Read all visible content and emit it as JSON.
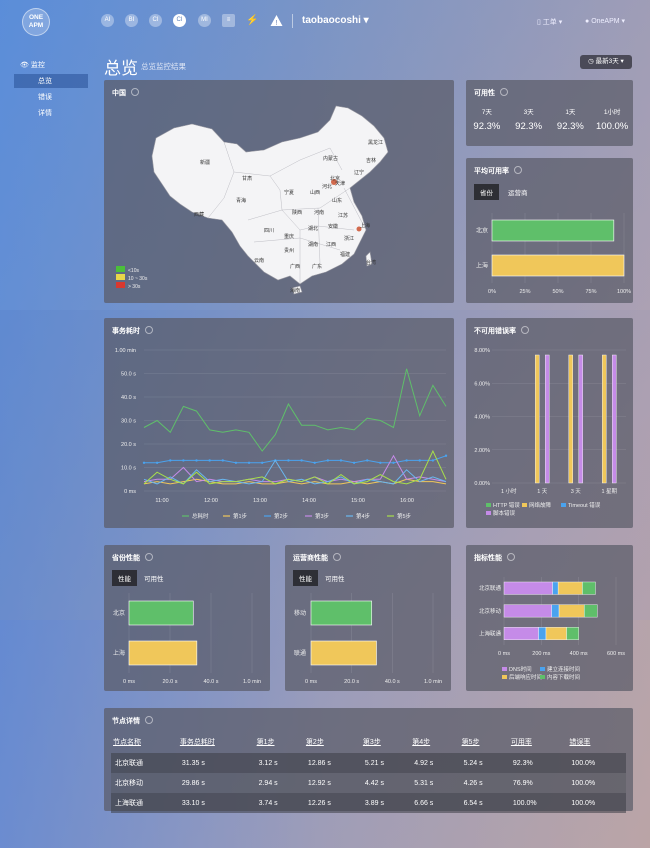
{
  "colors": {
    "green": "#5fbf6a",
    "yellow": "#f0c75a",
    "blue": "#4aa3ef",
    "purple": "#c58be8",
    "lime": "#a8e04a",
    "red": "#d9382f",
    "panel": "#5a5c68"
  },
  "topbar": {
    "logo_line1": "ONE",
    "logo_line2": "APM",
    "nav": [
      {
        "icon": "ai-icon",
        "label": "AI"
      },
      {
        "icon": "bi-icon",
        "label": "BI"
      },
      {
        "icon": "ci-icon",
        "label": "CI"
      },
      {
        "icon": "cloud-insight-icon",
        "label": "CI"
      },
      {
        "icon": "mi-icon",
        "label": "MI"
      },
      {
        "icon": "grid-icon",
        "label": "≡"
      },
      {
        "icon": "plug-icon",
        "label": "⚡"
      },
      {
        "icon": "alert-icon",
        "label": "!"
      }
    ],
    "app_name": "taobaocoshi ▾",
    "workorder": "工单 ▾",
    "user": "OneAPM ▾"
  },
  "sidebar": {
    "section": "监控",
    "items": [
      {
        "label": "总览"
      },
      {
        "label": "错误"
      },
      {
        "label": "详情"
      }
    ]
  },
  "header": {
    "title": "总览",
    "subtitle": "总览监控结果",
    "range": "最新3天 ▾"
  },
  "map": {
    "title": "中国",
    "legend": [
      "<10s",
      "10 ~ 30s",
      "> 30s"
    ],
    "provinces": [
      {
        "name": "黑龙江"
      },
      {
        "name": "吉林"
      },
      {
        "name": "辽宁"
      },
      {
        "name": "内蒙古"
      },
      {
        "name": "北京"
      },
      {
        "name": "天津"
      },
      {
        "name": "河北"
      },
      {
        "name": "新疆"
      },
      {
        "name": "甘肃"
      },
      {
        "name": "宁夏"
      },
      {
        "name": "山西"
      },
      {
        "name": "山东"
      },
      {
        "name": "青海"
      },
      {
        "name": "陕西"
      },
      {
        "name": "河南"
      },
      {
        "name": "江苏"
      },
      {
        "name": "西藏"
      },
      {
        "name": "四川"
      },
      {
        "name": "湖北"
      },
      {
        "name": "安徽"
      },
      {
        "name": "上海"
      },
      {
        "name": "重庆"
      },
      {
        "name": "浙江"
      },
      {
        "name": "湖南"
      },
      {
        "name": "江西"
      },
      {
        "name": "贵州"
      },
      {
        "name": "福建"
      },
      {
        "name": "云南"
      },
      {
        "name": "广西"
      },
      {
        "name": "广东"
      },
      {
        "name": "台湾"
      },
      {
        "name": "海南"
      }
    ]
  },
  "availability": {
    "title": "可用性",
    "headers": [
      "7天",
      "3天",
      "1天",
      "1小时"
    ],
    "values": [
      "92.3%",
      "92.3%",
      "92.3%",
      "100.0%"
    ]
  },
  "avg_availability": {
    "title": "平均可用率",
    "tabs": [
      "省份",
      "运营商"
    ],
    "chart_data": {
      "type": "bar",
      "orientation": "horizontal",
      "categories": [
        "北京",
        "上海"
      ],
      "values": [
        92.3,
        100
      ],
      "xticks": [
        "0%",
        "25%",
        "50%",
        "75%",
        "100%"
      ],
      "xlim": [
        0,
        100
      ]
    }
  },
  "txn_time": {
    "title": "事务耗时",
    "chart_data": {
      "type": "line",
      "yticks": [
        "0 ms",
        "10.0 s",
        "20.0 s",
        "30.0 s",
        "40.0 s",
        "50.0 s",
        "1.00 min"
      ],
      "xticks": [
        "11:00",
        "12:00",
        "13:00",
        "14:00",
        "15:00",
        "16:00"
      ],
      "ylim": [
        0,
        60
      ],
      "series": [
        {
          "name": "总耗时",
          "values": [
            27,
            30,
            25,
            36,
            34,
            26,
            25,
            26,
            25,
            17,
            24,
            37,
            28,
            28,
            26,
            27,
            26,
            31,
            30,
            27,
            52,
            32,
            45,
            36
          ]
        },
        {
          "name": "第1步",
          "values": [
            3,
            4,
            3,
            4,
            5,
            4,
            3,
            3,
            4,
            3,
            3,
            4,
            3,
            4,
            3,
            3,
            4,
            3,
            4,
            3,
            5,
            4,
            4,
            3
          ]
        },
        {
          "name": "第2步",
          "values": [
            12,
            12,
            13,
            13,
            13,
            13,
            13,
            12,
            12,
            12,
            13,
            13,
            13,
            12,
            13,
            13,
            12,
            13,
            12,
            12,
            13,
            13,
            13,
            15
          ]
        },
        {
          "name": "第3步",
          "values": [
            4,
            5,
            5,
            10,
            4,
            5,
            4,
            4,
            5,
            4,
            4,
            5,
            4,
            6,
            4,
            5,
            4,
            5,
            5,
            15,
            5,
            6,
            5,
            4
          ]
        },
        {
          "name": "第4步",
          "values": [
            5,
            3,
            6,
            3,
            9,
            4,
            5,
            4,
            3,
            4,
            13,
            4,
            5,
            3,
            4,
            6,
            3,
            5,
            4,
            3,
            9,
            4,
            6,
            4
          ]
        },
        {
          "name": "第5步",
          "values": [
            3,
            8,
            5,
            3,
            8,
            3,
            4,
            4,
            5,
            6,
            3,
            5,
            4,
            6,
            3,
            7,
            3,
            4,
            7,
            4,
            3,
            5,
            17,
            5
          ]
        }
      ]
    }
  },
  "error_rate": {
    "title": "不可用错误率",
    "chart_data": {
      "type": "bar",
      "categories": [
        "1 小时",
        "1 天",
        "3 天",
        "1 星期"
      ],
      "yticks": [
        "0.00%",
        "2.00%",
        "4.00%",
        "6.00%",
        "8.00%"
      ],
      "ylim": [
        0,
        8
      ],
      "series": [
        {
          "name": "HTTP 错误",
          "values": [
            0,
            0,
            0,
            0
          ]
        },
        {
          "name": "网络故障",
          "values": [
            0,
            7.7,
            7.7,
            7.7
          ]
        },
        {
          "name": "Timeout 错误",
          "values": [
            0,
            0,
            0,
            0
          ]
        },
        {
          "name": "脚本错误",
          "values": [
            0,
            7.7,
            7.7,
            7.7
          ]
        }
      ]
    }
  },
  "province_perf": {
    "title": "省份性能",
    "tabs": [
      "性能",
      "可用性"
    ],
    "chart_data": {
      "type": "bar",
      "orientation": "horizontal",
      "categories": [
        "北京",
        "上海"
      ],
      "values": [
        31.35,
        33.1
      ],
      "xticks": [
        "0 ms",
        "20.0 s",
        "40.0 s",
        "1.0 min"
      ],
      "xlim": [
        0,
        60
      ]
    }
  },
  "isp_perf": {
    "title": "运营商性能",
    "tabs": [
      "性能",
      "可用性"
    ],
    "chart_data": {
      "type": "bar",
      "orientation": "horizontal",
      "categories": [
        "移动",
        "联通"
      ],
      "values": [
        29.86,
        32.2
      ],
      "xticks": [
        "0 ms",
        "20.0 s",
        "40.0 s",
        "1.0 min"
      ],
      "xlim": [
        0,
        60
      ]
    }
  },
  "metric_perf": {
    "title": "指标性能",
    "chart_data": {
      "type": "bar",
      "orientation": "horizontal",
      "stacked": true,
      "categories": [
        "北京联通",
        "北京移动",
        "上海联通"
      ],
      "xticks": [
        "0 ms",
        "200 ms",
        "400 ms",
        "600 ms"
      ],
      "xlim": [
        0,
        600
      ],
      "series": [
        {
          "name": "DNS时间",
          "values": [
            260,
            255,
            185
          ]
        },
        {
          "name": "建立连接时间",
          "values": [
            30,
            40,
            40
          ]
        },
        {
          "name": "后端响应时间",
          "values": [
            130,
            135,
            110
          ]
        },
        {
          "name": "内容下载时间",
          "values": [
            70,
            70,
            65
          ]
        }
      ]
    }
  },
  "node_detail": {
    "title": "节点详情",
    "columns": [
      "节点名称",
      "事务总耗时",
      "第1步",
      "第2步",
      "第3步",
      "第4步",
      "第5步",
      "可用率",
      "错误率"
    ],
    "rows": [
      [
        "北京联通",
        "31.35 s",
        "3.12 s",
        "12.86 s",
        "5.21 s",
        "4.92 s",
        "5.24 s",
        "92.3%",
        "100.0%"
      ],
      [
        "北京移动",
        "29.86 s",
        "2.94 s",
        "12.92 s",
        "4.42 s",
        "5.31 s",
        "4.26 s",
        "76.9%",
        "100.0%"
      ],
      [
        "上海联通",
        "33.10 s",
        "3.74 s",
        "12.26 s",
        "3.89 s",
        "6.66 s",
        "6.54 s",
        "100.0%",
        "100.0%"
      ]
    ]
  }
}
